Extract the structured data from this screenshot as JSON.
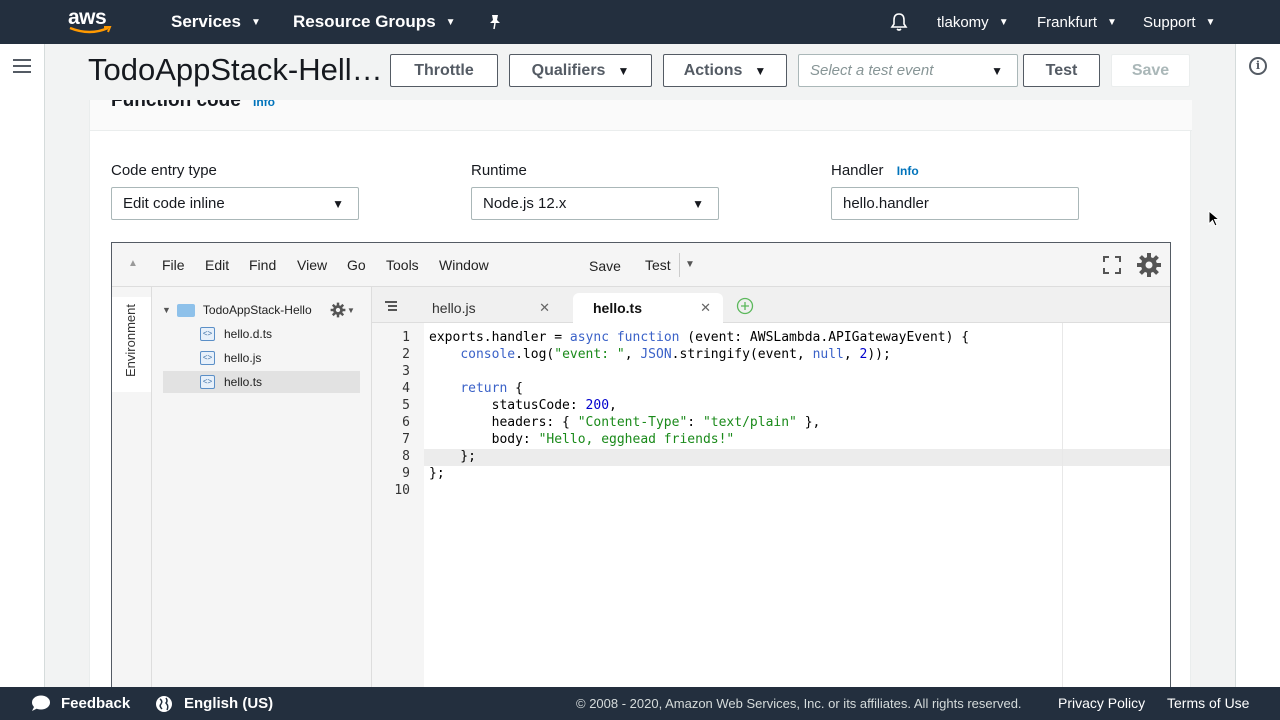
{
  "nav": {
    "logo": "aws",
    "services": "Services",
    "resource_groups": "Resource Groups",
    "user": "tlakomy",
    "region": "Frankfurt",
    "support": "Support"
  },
  "header": {
    "function_title": "TodoAppStack-Hell…",
    "throttle": "Throttle",
    "qualifiers": "Qualifiers",
    "actions": "Actions",
    "test_event_placeholder": "Select a test event",
    "test": "Test",
    "save": "Save"
  },
  "panel": {
    "title": "Function code",
    "info": "Info",
    "code_entry_label": "Code entry type",
    "code_entry_value": "Edit code inline",
    "runtime_label": "Runtime",
    "runtime_value": "Node.js 12.x",
    "handler_label": "Handler",
    "handler_info": "Info",
    "handler_value": "hello.handler"
  },
  "editor": {
    "menu": [
      "File",
      "Edit",
      "Find",
      "View",
      "Go",
      "Tools",
      "Window"
    ],
    "save": "Save",
    "test": "Test",
    "environment": "Environment",
    "tree": {
      "folder": "TodoAppStack-Hello",
      "files": [
        "hello.d.ts",
        "hello.js",
        "hello.ts"
      ]
    },
    "tabs": [
      "hello.js",
      "hello.ts"
    ],
    "lines": [
      "1",
      "2",
      "3",
      "4",
      "5",
      "6",
      "7",
      "8",
      "9",
      "10"
    ]
  },
  "footer": {
    "feedback": "Feedback",
    "language": "English (US)",
    "copyright": "© 2008 - 2020, Amazon Web Services, Inc. or its affiliates. All rights reserved.",
    "privacy": "Privacy Policy",
    "terms": "Terms of Use"
  }
}
